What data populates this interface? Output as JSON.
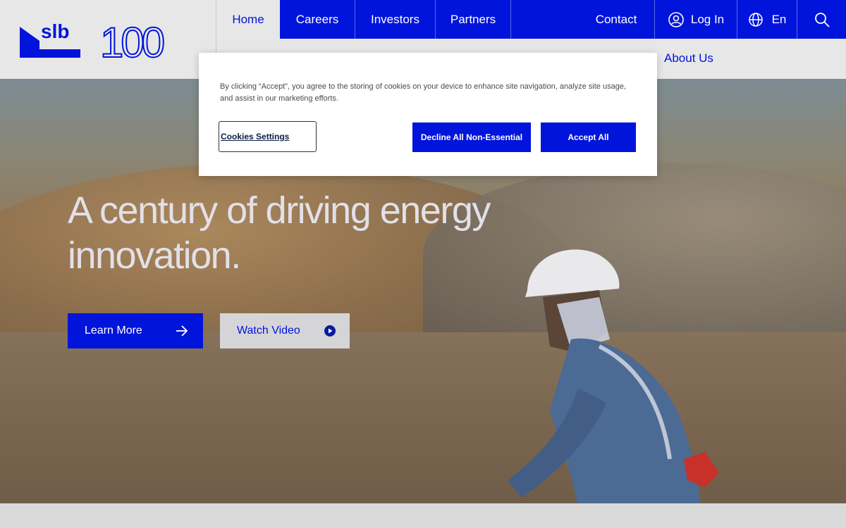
{
  "header": {
    "logo_text": "slb",
    "anniversary_text": "100",
    "nav": [
      {
        "label": "Home"
      },
      {
        "label": "Careers"
      },
      {
        "label": "Investors"
      },
      {
        "label": "Partners"
      },
      {
        "label": "Contact"
      },
      {
        "label": "Log In"
      },
      {
        "label": "En"
      }
    ],
    "subnav_label": "About Us",
    "icons": {
      "user": "user-circle-icon",
      "globe": "globe-icon",
      "search": "search-icon"
    }
  },
  "hero": {
    "headline": "A century of driving energy innovation.",
    "learn_more": "Learn More",
    "watch_video": "Watch Video"
  },
  "cookie": {
    "text": "By clicking “Accept”, you agree to the storing of cookies on your device to enhance site navigation, analyze site usage, and assist in our marketing efforts.",
    "settings_label": "Cookies Settings",
    "decline_label": "Decline All Non-Essential",
    "accept_label": "Accept All"
  },
  "colors": {
    "brand_blue": "#0014dc",
    "header_bg": "#e7e7e7"
  }
}
